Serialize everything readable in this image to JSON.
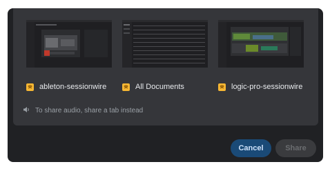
{
  "tabs": [
    {
      "label": "ableton-sessionwire",
      "icon": "sessionwire-favicon"
    },
    {
      "label": "All Documents",
      "icon": "sessionwire-favicon"
    },
    {
      "label": "logic-pro-sessionwire",
      "icon": "sessionwire-favicon"
    }
  ],
  "audio_note": {
    "text": "To share audio, share a tab instead",
    "icon": "speaker-icon"
  },
  "buttons": {
    "cancel_label": "Cancel",
    "share_label": "Share"
  },
  "colors": {
    "accent": "#1a4a77",
    "favicon": "#f7b733",
    "dialog_bg": "#202124",
    "panel_bg": "#35363a"
  }
}
